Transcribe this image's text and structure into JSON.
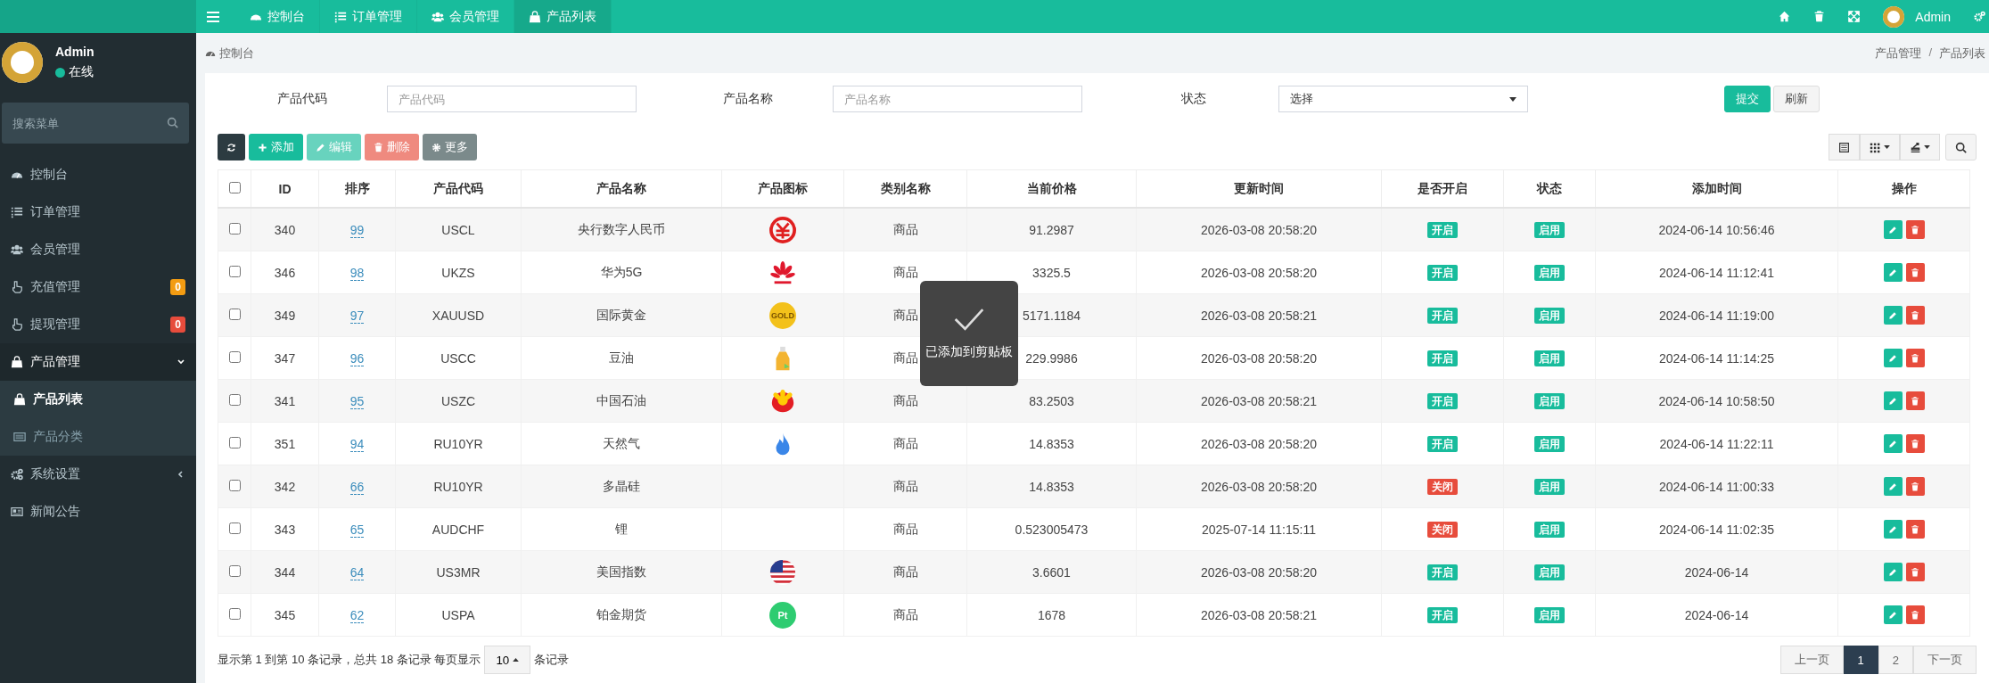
{
  "topbar": {
    "tabs": [
      {
        "label": "控制台",
        "kind": "dashboard",
        "selected": false
      },
      {
        "label": "订单管理",
        "kind": "list",
        "selected": false
      },
      {
        "label": "会员管理",
        "kind": "users",
        "selected": false
      },
      {
        "label": "产品列表",
        "kind": "bag",
        "selected": true
      }
    ],
    "user": "Admin"
  },
  "sidebar": {
    "user": {
      "name": "Admin",
      "status": "在线"
    },
    "search": {
      "placeholder": "搜索菜单"
    },
    "items": [
      {
        "label": "控制台",
        "kind": "dashboard"
      },
      {
        "label": "订单管理",
        "kind": "list"
      },
      {
        "label": "会员管理",
        "kind": "users"
      },
      {
        "label": "充值管理",
        "kind": "hand",
        "badge": {
          "count": "0",
          "color": "#f39c12"
        }
      },
      {
        "label": "提现管理",
        "kind": "hand",
        "badge": {
          "count": "0",
          "color": "#e74c3c"
        }
      },
      {
        "label": "产品管理",
        "kind": "bag",
        "expanded": true,
        "children": [
          {
            "label": "产品列表",
            "kind": "bag",
            "selected": true
          },
          {
            "label": "产品分类",
            "kind": "table",
            "selected": false
          }
        ]
      },
      {
        "label": "系统设置",
        "kind": "gears",
        "expanded": false
      },
      {
        "label": "新闻公告",
        "kind": "news"
      }
    ]
  },
  "breadcrumb": {
    "home": "控制台",
    "path": [
      "产品管理",
      "产品列表"
    ],
    "separator": "/"
  },
  "filters": [
    {
      "label": "产品代码",
      "kind": "text",
      "placeholder": "产品代码"
    },
    {
      "label": "产品名称",
      "kind": "text",
      "placeholder": "产品名称"
    },
    {
      "label": "状态",
      "kind": "select",
      "value": "选择"
    }
  ],
  "form_buttons": [
    {
      "label": "提交",
      "kind": "primary"
    },
    {
      "label": "刷新",
      "kind": "default"
    }
  ],
  "toolbar": [
    {
      "kind": "refresh",
      "disabled": false
    },
    {
      "kind": "add",
      "label": "添加",
      "disabled": false
    },
    {
      "kind": "edit",
      "label": "编辑",
      "disabled": true
    },
    {
      "kind": "delete",
      "label": "删除",
      "disabled": true
    },
    {
      "kind": "more",
      "label": "更多",
      "disabled": false
    }
  ],
  "table": {
    "header_checked": false,
    "columns": [
      "ID",
      "排序",
      "产品代码",
      "产品名称",
      "产品图标",
      "类别名称",
      "当前价格",
      "更新时间",
      "是否开启",
      "状态",
      "添加时间",
      "操作"
    ],
    "rows": [
      {
        "checked": false,
        "id": "340",
        "sort": "99",
        "code": "USCL",
        "name": "央行数字人民币",
        "icon": {
          "kind": "yuan"
        },
        "category": "商品",
        "price": "91.2987",
        "updated": "2026-03-08 20:58:20",
        "open": {
          "label": "开启",
          "on": true
        },
        "status": "启用",
        "added": "2024-06-14 10:56:46"
      },
      {
        "checked": false,
        "id": "346",
        "sort": "98",
        "code": "UKZS",
        "name": "华为5G",
        "icon": {
          "kind": "petals"
        },
        "category": "商品",
        "price": "3325.5",
        "updated": "2026-03-08 20:58:20",
        "open": {
          "label": "开启",
          "on": true
        },
        "status": "启用",
        "added": "2024-06-14 11:12:41"
      },
      {
        "checked": false,
        "id": "349",
        "sort": "97",
        "code": "XAUUSD",
        "name": "国际黄金",
        "icon": {
          "kind": "coin",
          "label": "GOLD"
        },
        "category": "商品",
        "price": "5171.1184",
        "updated": "2026-03-08 20:58:21",
        "open": {
          "label": "开启",
          "on": true
        },
        "status": "启用",
        "added": "2024-06-14 11:19:00"
      },
      {
        "checked": false,
        "id": "347",
        "sort": "96",
        "code": "USCC",
        "name": "豆油",
        "icon": {
          "kind": "bottle"
        },
        "category": "商品",
        "price": "229.9986",
        "updated": "2026-03-08 20:58:20",
        "open": {
          "label": "开启",
          "on": true
        },
        "status": "启用",
        "added": "2024-06-14 11:14:25"
      },
      {
        "checked": false,
        "id": "341",
        "sort": "95",
        "code": "USZC",
        "name": "中国石油",
        "icon": {
          "kind": "sun"
        },
        "category": "商品",
        "price": "83.2503",
        "updated": "2026-03-08 20:58:21",
        "open": {
          "label": "开启",
          "on": true
        },
        "status": "启用",
        "added": "2024-06-14 10:58:50"
      },
      {
        "checked": false,
        "id": "351",
        "sort": "94",
        "code": "RU10YR",
        "name": "天然气",
        "icon": {
          "kind": "flame"
        },
        "category": "商品",
        "price": "14.8353",
        "updated": "2026-03-08 20:58:20",
        "open": {
          "label": "开启",
          "on": true
        },
        "status": "启用",
        "added": "2024-06-14 11:22:11"
      },
      {
        "checked": false,
        "id": "342",
        "sort": "66",
        "code": "RU10YR",
        "name": "多晶硅",
        "category": "商品",
        "price": "14.8353",
        "updated": "2026-03-08 20:58:20",
        "open": {
          "label": "关闭",
          "on": false
        },
        "status": "启用",
        "added": "2024-06-14 11:00:33"
      },
      {
        "checked": false,
        "id": "343",
        "sort": "65",
        "code": "AUDCHF",
        "name": "锂",
        "category": "商品",
        "price": "0.523005473",
        "updated": "2025-07-14 11:15:11",
        "open": {
          "label": "关闭",
          "on": false
        },
        "status": "启用",
        "added": "2024-06-14 11:02:35"
      },
      {
        "checked": false,
        "id": "344",
        "sort": "64",
        "code": "US3MR",
        "name": "美国指数",
        "icon": {
          "kind": "flag"
        },
        "category": "商品",
        "price": "3.6601",
        "updated": "2026-03-08 20:58:20",
        "open": {
          "label": "开启",
          "on": true
        },
        "status": "启用",
        "added": "2024-06-14"
      },
      {
        "checked": false,
        "id": "345",
        "sort": "62",
        "code": "USPA",
        "name": "铂金期货",
        "icon": {
          "kind": "badge",
          "label": "Pt"
        },
        "category": "商品",
        "price": "1678",
        "updated": "2026-03-08 20:58:21",
        "open": {
          "label": "开启",
          "on": true
        },
        "status": "启用",
        "added": "2024-06-14"
      }
    ]
  },
  "footer": {
    "summary": "显示第 1 到第 10 条记录，总共 18 条记录 每页显示",
    "page_size": "10",
    "suffix": "条记录"
  },
  "pagination": [
    {
      "label": "上一页",
      "selected": false
    },
    {
      "label": "1",
      "selected": true
    },
    {
      "label": "2",
      "selected": false
    },
    {
      "label": "下一页",
      "selected": false
    }
  ],
  "toast": {
    "message": "已添加到剪贴板"
  }
}
